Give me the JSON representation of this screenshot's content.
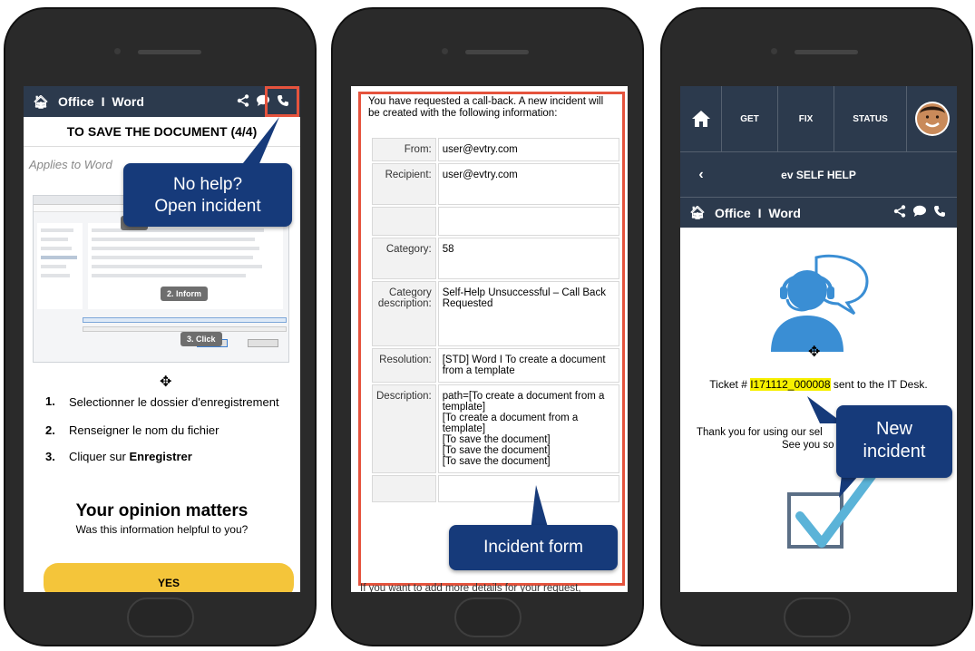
{
  "phone1": {
    "breadcrumb": {
      "office": "Office",
      "separator": "I",
      "word": "Word"
    },
    "doc_title": "TO SAVE THE DOCUMENT (4/4)",
    "applies": "Applies to Word",
    "callout": {
      "line1": "No help?",
      "line2": "Open incident"
    },
    "screenshot_tags": {
      "tag1": "1. S",
      "tag2": "2. Inform",
      "tag3": "3. Click"
    },
    "steps": [
      {
        "num": "1.",
        "text": "Selectionner le dossier d'enregistrement"
      },
      {
        "num": "2.",
        "text": "Renseigner le nom du fichier"
      },
      {
        "num": "3.",
        "text": "Cliquer sur ",
        "bold": "Enregistrer"
      }
    ],
    "opinion_title": "Your opinion matters",
    "opinion_sub": "Was this information helpful to you?",
    "yes_label": "YES"
  },
  "phone2": {
    "intro": "You have requested a call-back. A new incident will be created with the following information:",
    "rows": [
      {
        "label": "From:",
        "value": "user@evtry.com"
      },
      {
        "label": "Recipient:",
        "value": "user@evtry.com"
      },
      {
        "label": "",
        "value": ""
      },
      {
        "label": "Category:",
        "value": "58"
      },
      {
        "label": "Category description:",
        "value": "Self-Help Unsuccessful – Call Back Requested"
      },
      {
        "label": "Resolution:",
        "value": "[STD] Word I To create a document from a template"
      },
      {
        "label": "Description:",
        "value": "path=[To create a document from a template]\n[To create a document from a template]\n[To save the document]\n[To save the document]\n[To save the document]"
      },
      {
        "label": "",
        "value": ""
      }
    ],
    "callout": "Incident form",
    "below": "If you want to add more details for your request,"
  },
  "phone3": {
    "menu": {
      "get": "GET",
      "fix": "FIX",
      "status": "STATUS"
    },
    "title": "ev SELF HELP",
    "breadcrumb": {
      "office": "Office",
      "separator": "I",
      "word": "Word"
    },
    "ticket_prefix": "Ticket # ",
    "ticket_id": "I171112_000008",
    "ticket_suffix": " sent to the IT Desk.",
    "thanks_line1": "Thank you for using our sel",
    "thanks_line2": "See you so",
    "callout": {
      "line1": "New",
      "line2": "incident"
    }
  },
  "colors": {
    "navbar": "#2c3a4d",
    "callout": "#163a7a",
    "highlight": "#e5533d",
    "yes": "#f4c53a",
    "agent": "#3a8ed4",
    "ticket_highlight": "#f7f000"
  },
  "icons": [
    "home-icon",
    "share-icon",
    "chat-icon",
    "phone-icon",
    "back-chevron-icon",
    "avatar",
    "agent-headset-icon",
    "checkbox-checked-icon",
    "move-cursor-icon"
  ]
}
